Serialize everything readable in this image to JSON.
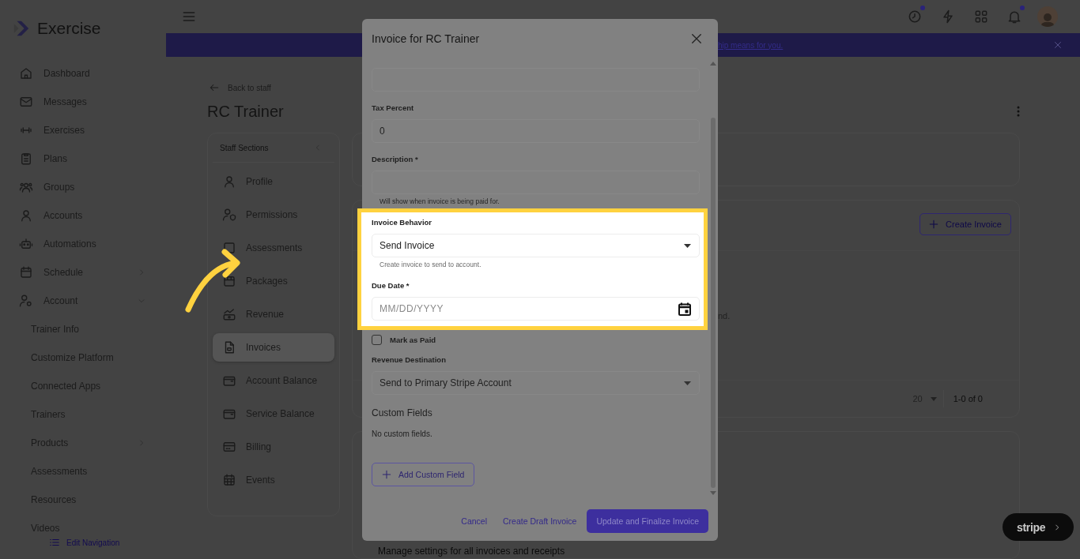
{
  "sidebar": {
    "brand": "Exercise",
    "items": [
      {
        "label": "Dashboard",
        "kind": "link"
      },
      {
        "label": "Messages",
        "kind": "link"
      },
      {
        "label": "Exercises",
        "kind": "link"
      },
      {
        "label": "Plans",
        "kind": "link"
      },
      {
        "label": "Groups",
        "kind": "link"
      },
      {
        "label": "Accounts",
        "kind": "link"
      },
      {
        "label": "Automations",
        "kind": "link"
      },
      {
        "label": "Schedule",
        "kind": "group",
        "expanded": false
      },
      {
        "label": "Account",
        "kind": "group",
        "expanded": true,
        "children": [
          {
            "label": "Trainer Info",
            "kind": "link"
          },
          {
            "label": "Customize Platform",
            "kind": "link"
          },
          {
            "label": "Connected Apps",
            "kind": "link"
          },
          {
            "label": "Trainers",
            "kind": "link"
          },
          {
            "label": "Products",
            "kind": "group",
            "expanded": false
          },
          {
            "label": "Assessments",
            "kind": "link"
          },
          {
            "label": "Resources",
            "kind": "link"
          },
          {
            "label": "Videos",
            "kind": "link"
          }
        ]
      }
    ],
    "edit_navigation": "Edit Navigation"
  },
  "topbar": {
    "icons": [
      {
        "dot": true
      },
      {
        "dot": false
      },
      {
        "dot": false
      },
      {
        "dot": true
      }
    ]
  },
  "banner": {
    "text": "hip means for you."
  },
  "page": {
    "back_link": "Back to staff",
    "title": "RC Trainer",
    "staff_sections": {
      "title": "Staff Sections",
      "items": [
        {
          "label": "Profile",
          "selected": false
        },
        {
          "label": "Permissions",
          "selected": false
        },
        {
          "label": "Assessments",
          "selected": false
        },
        {
          "label": "Packages",
          "selected": false
        },
        {
          "label": "Revenue",
          "selected": false
        },
        {
          "label": "Invoices",
          "selected": true
        },
        {
          "label": "Account Balance",
          "selected": false
        },
        {
          "label": "Service Balance",
          "selected": false
        },
        {
          "label": "Billing",
          "selected": false
        },
        {
          "label": "Events",
          "selected": false
        }
      ]
    },
    "invoices_card": {
      "create_button": "Create Invoice",
      "empty_text": "nd.",
      "rows_per_page": "20",
      "range": "1-0 of 0"
    },
    "settings_text": "Manage settings for all invoices and receipts"
  },
  "modal": {
    "title": "Invoice for RC Trainer",
    "fields": [
      {
        "kind": "input",
        "highlighted": false
      },
      {
        "kind": "input",
        "label": "Tax Percent",
        "value": "0",
        "highlighted": false
      },
      {
        "kind": "input",
        "label": "Description *",
        "helper": "Will show when invoice is being paid for.",
        "highlighted": false
      },
      {
        "kind": "select",
        "label": "Invoice Behavior",
        "value": "Send Invoice",
        "helper": "Create invoice to send to account.",
        "highlighted": true
      },
      {
        "kind": "date",
        "label": "Due Date *",
        "placeholder": "MM/DD/YYYY",
        "highlighted": true
      },
      {
        "kind": "checkbox",
        "label": "Mark as Paid",
        "checked": false,
        "highlighted": false
      },
      {
        "kind": "select",
        "label": "Revenue Destination",
        "value": "Send to Primary Stripe Account",
        "highlighted": false
      }
    ],
    "custom_fields": {
      "title": "Custom Fields",
      "empty_text": "No custom fields.",
      "add_button": "Add Custom Field"
    },
    "buttons": [
      {
        "label": "Cancel",
        "kind": "text"
      },
      {
        "label": "Create Draft Invoice",
        "kind": "text"
      },
      {
        "label": "Update and Finalize Invoice",
        "kind": "primary"
      }
    ]
  },
  "stripe_badge": "stripe"
}
